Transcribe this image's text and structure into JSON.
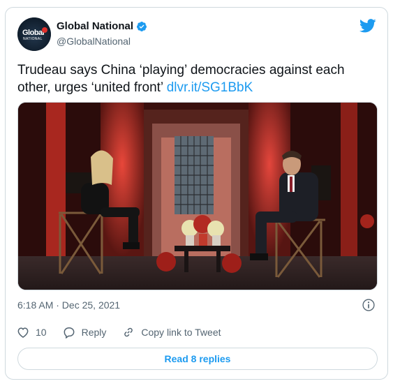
{
  "author": {
    "display_name": "Global National",
    "handle": "@GlobalNational",
    "avatar_logo_text": "Global",
    "avatar_logo_sub": "NATIONAL",
    "verified": true
  },
  "tweet": {
    "text": "Trudeau says China ‘playing’ democracies against each other, urges ‘united front’ ",
    "link": "dlvr.it/SG1BbK",
    "timestamp": "6:18 AM · Dec 25, 2021"
  },
  "actions": {
    "like_count": "10",
    "reply_label": "Reply",
    "copy_link_label": "Copy link to Tweet"
  },
  "read_replies_label": "Read 8 replies",
  "colors": {
    "accent": "#1d9bf0",
    "text": "#0f1419",
    "muted": "#536471",
    "border": "#cfd9de",
    "like_red": "#f91880"
  },
  "icons": {
    "brand": "twitter-bird-icon",
    "verified": "verified-badge-icon",
    "info": "info-icon",
    "like": "heart-icon",
    "reply": "reply-bubble-icon",
    "copy": "link-icon"
  }
}
